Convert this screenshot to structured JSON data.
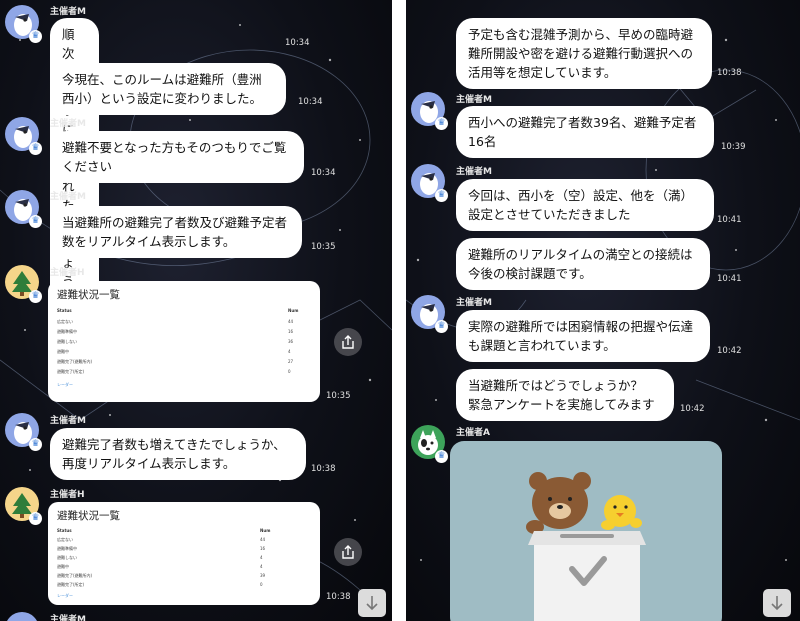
{
  "left": {
    "messages": [
      {
        "sender": "主催者M",
        "text": "順次お戻りになられたでしょうか。",
        "time": "10:34"
      },
      {
        "text": "今現在、このルームは避難所（豊洲西小）という設定に変わりました。",
        "time": "10:34"
      },
      {
        "sender": "主催者M",
        "text": "避難不要となった方もそのつもりでご覧ください",
        "time": "10:34"
      },
      {
        "sender": "主催者M",
        "text": "当避難所の避難完了者数及び避難予定者数をリアルタイム表示します。",
        "time": "10:35"
      },
      {
        "sender": "主催者H",
        "time": "10:35"
      },
      {
        "sender": "主催者M",
        "text": "避難完了者数も増えてきたでしょうか、再度リアルタイム表示します。",
        "time": "10:38"
      },
      {
        "sender": "主催者H",
        "time": "10:38"
      },
      {
        "sender": "主催者M"
      }
    ],
    "card1": {
      "title": "避難状況一覧",
      "col_status": "Status",
      "col_num": "Num",
      "rows": [
        {
          "label": "広定ない",
          "num": "44"
        },
        {
          "label": "避難準備中",
          "num": "16"
        },
        {
          "label": "避難しない",
          "num": "36"
        },
        {
          "label": "避難中",
          "num": "4"
        },
        {
          "label": "避難完了(避難所内)",
          "num": "27"
        },
        {
          "label": "避難完了(所定)",
          "num": "0"
        }
      ],
      "link": "レーダー"
    },
    "card2": {
      "title": "避難状況一覧",
      "col_status": "Status",
      "col_num": "Num",
      "rows": [
        {
          "label": "広定ない",
          "num": "44"
        },
        {
          "label": "避難準備中",
          "num": "16"
        },
        {
          "label": "避難しない",
          "num": "4"
        },
        {
          "label": "避難中",
          "num": "4"
        },
        {
          "label": "避難完了(避難所内)",
          "num": "39"
        },
        {
          "label": "避難完了(所定)",
          "num": "0"
        }
      ],
      "link": "レーダー"
    }
  },
  "right": {
    "messages": [
      {
        "text": "予定も含む混雑予測から、早めの臨時避難所開設や密を避ける避難行動選択への活用等を想定しています。",
        "time": "10:38"
      },
      {
        "sender": "主催者M",
        "text": "西小への避難完了者数39名、避難予定者16名",
        "time": "10:39"
      },
      {
        "sender": "主催者M",
        "text": "今回は、西小を（空）設定、他を（満）設定とさせていただきました",
        "time": "10:41"
      },
      {
        "text": "避難所のリアルタイムの満空との接続は今後の検討課題です。",
        "time": "10:41"
      },
      {
        "sender": "主催者M",
        "text": "実際の避難所では困窮情報の把握や伝達も課題と言われています。",
        "time": "10:42"
      },
      {
        "text": "当避難所ではどうでしょうか？\n緊急アンケートを実施してみます",
        "time": "10:42"
      },
      {
        "sender": "主催者A"
      }
    ]
  },
  "icons": {
    "crown": "crown-icon",
    "share": "share-icon",
    "down": "arrow-down-icon"
  },
  "colors": {
    "background": "#0e1018",
    "bubble": "#ffffff",
    "sticker_bg": "#9fbcc4",
    "avatar_m": "#8fa6e6",
    "avatar_h": "#f5d58a",
    "avatar_a": "#3da35a"
  }
}
